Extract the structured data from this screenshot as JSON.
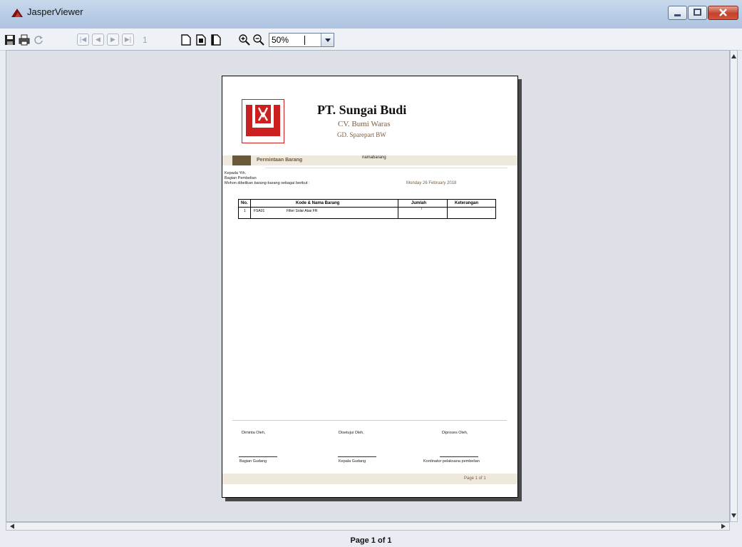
{
  "window": {
    "title": "JasperViewer"
  },
  "toolbar": {
    "page_number": "1",
    "zoom": "50%"
  },
  "report": {
    "company": "PT. Sungai Budi",
    "subsidiary": "CV. Bumi Waras",
    "warehouse": "GD. Sparepart BW",
    "band_title": "Permintaan Barang",
    "band_field": "namabarang",
    "to_line1": "Kepada Yth.",
    "to_line2": "Bagian Pembelian",
    "request_line": "Mohon dibelikan barang-barang sebagai berikut :",
    "date": "Monday 26 February 2018",
    "table": {
      "headers": [
        "No.",
        "Kode & Nama Barang",
        "Jumlah",
        "Keterangan"
      ],
      "row": {
        "no": "1",
        "code": "FSA01",
        "name": "Filter Solar Atas FR",
        "qty": "7",
        "note": ""
      }
    },
    "signatures": {
      "requested_by": "Diminta Oleh,",
      "approved_by": "Disetujui Oleh,",
      "processed_by": "Diproses Oleh,",
      "role1": "Bagian Gudang",
      "role2": "Kepala Gudang",
      "role3": "Kordinator pelaksana pembelian"
    },
    "page_footer": "Page 1 of 1"
  },
  "status": {
    "text": "Page 1 of 1"
  }
}
